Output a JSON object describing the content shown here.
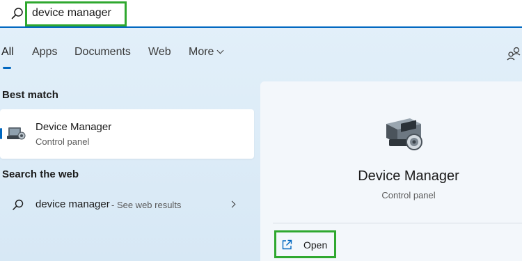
{
  "search": {
    "value": "device manager"
  },
  "tabs": [
    {
      "label": "All"
    },
    {
      "label": "Apps"
    },
    {
      "label": "Documents"
    },
    {
      "label": "Web"
    },
    {
      "label": "More"
    }
  ],
  "best_match": {
    "heading": "Best match",
    "title": "Device Manager",
    "subtitle": "Control panel"
  },
  "web": {
    "heading": "Search the web",
    "query": "device manager",
    "hint": "- See web results"
  },
  "detail": {
    "title": "Device Manager",
    "subtitle": "Control panel",
    "open_label": "Open"
  },
  "colors": {
    "accent": "#0067c0",
    "highlight": "#2fa82f",
    "background": "#dbeaf6"
  },
  "icons": {
    "search": "search-icon",
    "more": "chevron-down-icon",
    "people": "people-icon",
    "app": "device-manager-icon",
    "web_search": "search-icon",
    "arrow": "chevron-right-icon",
    "open": "open-external-icon"
  }
}
